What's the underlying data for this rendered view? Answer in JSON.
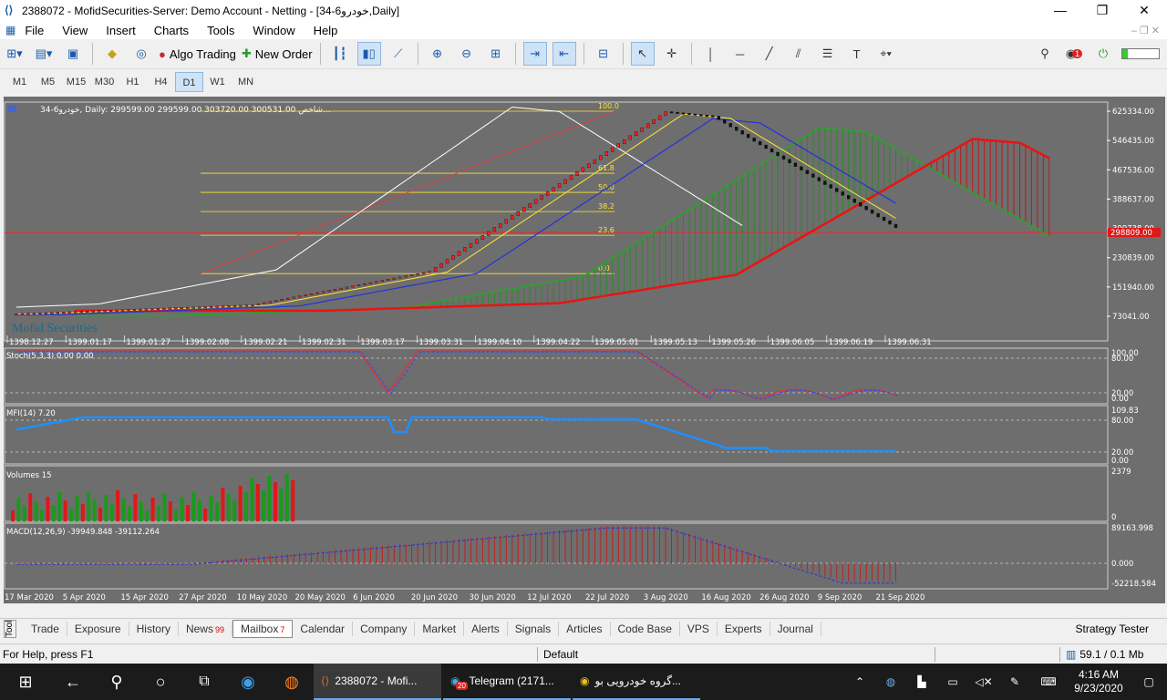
{
  "window": {
    "title": "2388072 - MofidSecurities-Server: Demo Account - Netting - [34-6خودرو,Daily]",
    "min": "—",
    "max": "❐",
    "close": "✕"
  },
  "menu": [
    "File",
    "View",
    "Insert",
    "Charts",
    "Tools",
    "Window",
    "Help"
  ],
  "toolbar": {
    "algo": "Algo Trading",
    "new_order": "New Order"
  },
  "timeframes": [
    "M1",
    "M5",
    "M15",
    "M30",
    "H1",
    "H4",
    "D1",
    "W1",
    "MN"
  ],
  "selected_tf": "D1",
  "chart": {
    "header": "34-6خودرو, Daily:  299599.00 299599.00 303720.00 300531.00  شاخص...",
    "watermark": "Mofid Securities",
    "price_ticks": [
      "625334.00",
      "546435.00",
      "467536.00",
      "388637.00",
      "309738.00",
      "230839.00",
      "151940.00",
      "73041.00"
    ],
    "price_tag": "298809.00",
    "fibo": [
      "100.0",
      "61.8",
      "50.0",
      "38.2",
      "23.6",
      "0.0"
    ],
    "top_dates": [
      "1398.12.27",
      "1399.01.17",
      "1399.01.27",
      "1399.02.08",
      "1399.02.21",
      "1399.02.31",
      "1399.03.17",
      "1399.03.31",
      "1399.04.10",
      "1399.04.22",
      "1399.05.01",
      "1399.05.13",
      "1399.05.26",
      "1399.06.05",
      "1399.06.19",
      "1399.06.31"
    ],
    "bottom_dates": [
      "17 Mar 2020",
      "5 Apr 2020",
      "15 Apr 2020",
      "27 Apr 2020",
      "10 May 2020",
      "20 May 2020",
      "6 Jun 2020",
      "20 Jun 2020",
      "30 Jun 2020",
      "12 Jul 2020",
      "22 Jul 2020",
      "3 Aug 2020",
      "16 Aug 2020",
      "26 Aug 2020",
      "9 Sep 2020",
      "21 Sep 2020"
    ],
    "stoch": {
      "label": "Stoch(5,3,3) 0.00 0.00",
      "ticks": [
        "100.00",
        "80.00",
        "20.00",
        "0.00"
      ]
    },
    "mfi": {
      "label": "MFI(14) 7.20",
      "ticks": [
        "109.83",
        "80.00",
        "20.00",
        "0.00"
      ]
    },
    "volumes": {
      "label": "Volumes 15",
      "ticks": [
        "2379",
        "0"
      ]
    },
    "macd": {
      "label": "MACD(12,26,9) -39949.848 -39112.264",
      "ticks": [
        "89163.998",
        "0.000",
        "-52218.584"
      ]
    }
  },
  "colors": {
    "bg": "#6e6e6e",
    "bull": "#1a9a1a",
    "bear": "#e0141e",
    "blue": "#2233dd",
    "white": "#ffffff",
    "yellow": "#ffe630",
    "macd": "#cc1111",
    "mfi": "#1e90ff"
  },
  "tabs": [
    {
      "label": "Trade",
      "badge": ""
    },
    {
      "label": "Exposure",
      "badge": ""
    },
    {
      "label": "History",
      "badge": ""
    },
    {
      "label": "News",
      "badge": "99"
    },
    {
      "label": "Mailbox",
      "badge": "7"
    },
    {
      "label": "Calendar",
      "badge": ""
    },
    {
      "label": "Company",
      "badge": ""
    },
    {
      "label": "Market",
      "badge": ""
    },
    {
      "label": "Alerts",
      "badge": ""
    },
    {
      "label": "Signals",
      "badge": ""
    },
    {
      "label": "Articles",
      "badge": ""
    },
    {
      "label": "Code Base",
      "badge": ""
    },
    {
      "label": "VPS",
      "badge": ""
    },
    {
      "label": "Experts",
      "badge": ""
    },
    {
      "label": "Journal",
      "badge": ""
    }
  ],
  "active_tab": "Mailbox",
  "strategy_tester": "Strategy Tester",
  "toolbox_label": "Toolbox",
  "status": {
    "help": "For Help, press F1",
    "profile": "Default",
    "traffic": "59.1 / 0.1 Mb"
  },
  "taskbar": {
    "tasks": [
      {
        "label": "2388072 - Mofi..."
      },
      {
        "label": "Telegram (2171..."
      },
      {
        "label": "گروه خودرویی بو..."
      }
    ],
    "telegram_badge": "20",
    "time": "4:16 AM",
    "date": "9/23/2020"
  }
}
